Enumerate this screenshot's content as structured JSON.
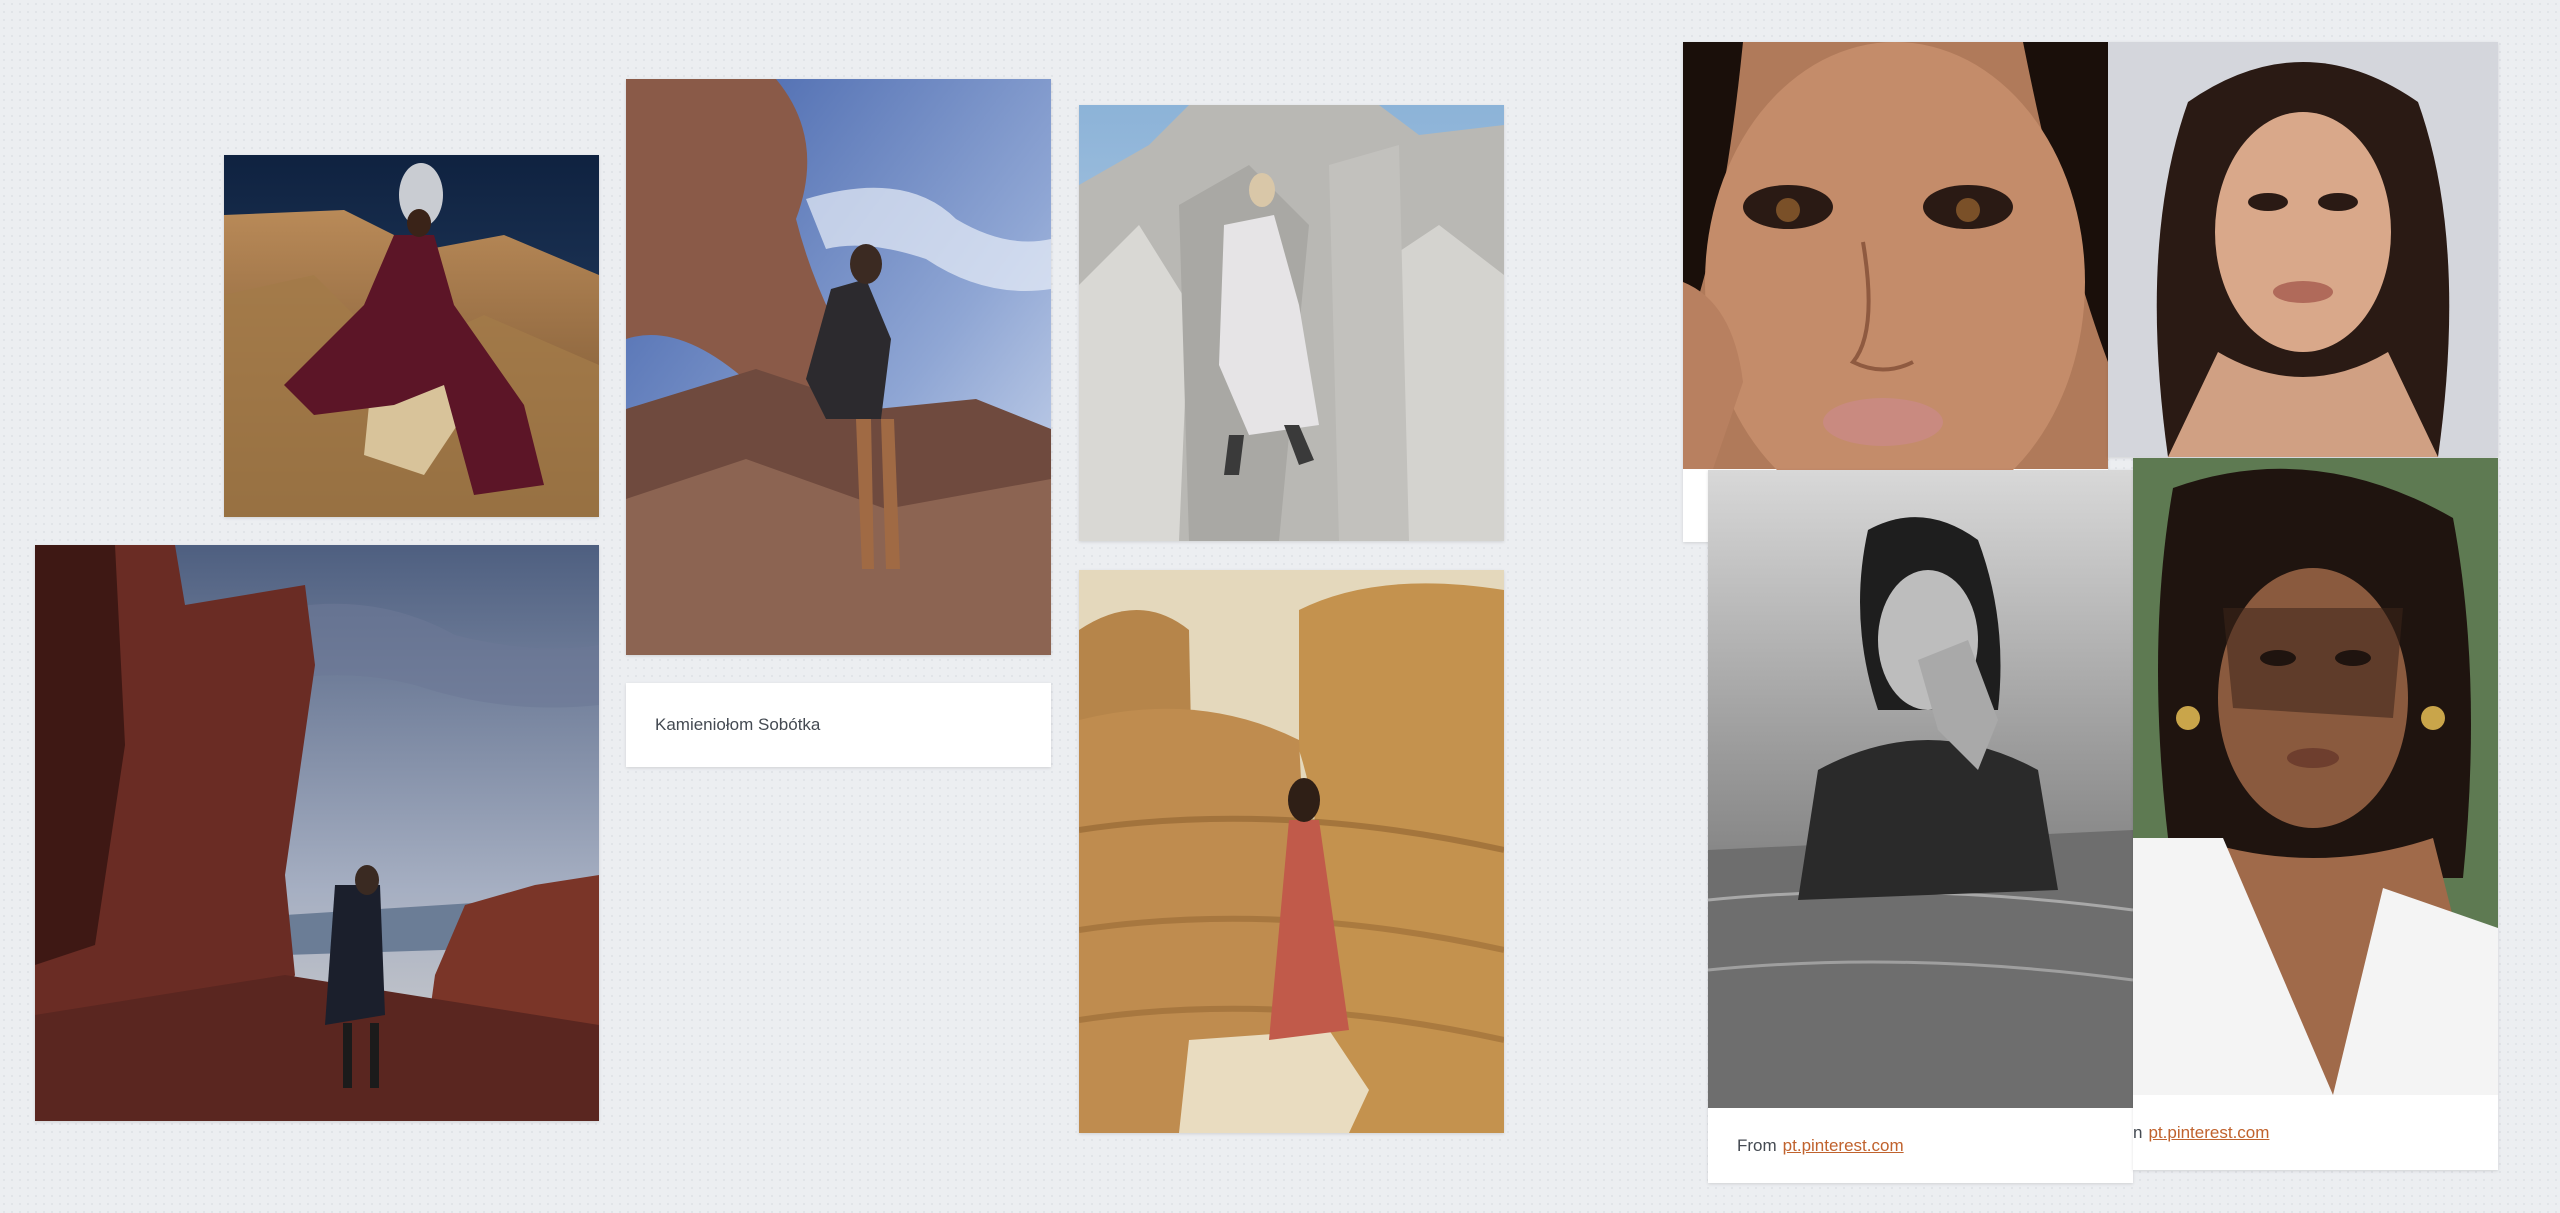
{
  "cards": {
    "quarry_caption": "Kamieniołom Sobótka",
    "source_prefix": "From",
    "source_link": "pt.pinterest.com",
    "source_prefix_partial": "n",
    "source_link_2": "pt.pinterest.com"
  },
  "colors": {
    "background": "#eceef1",
    "link": "#c0622d",
    "caption_text": "#444a52"
  }
}
